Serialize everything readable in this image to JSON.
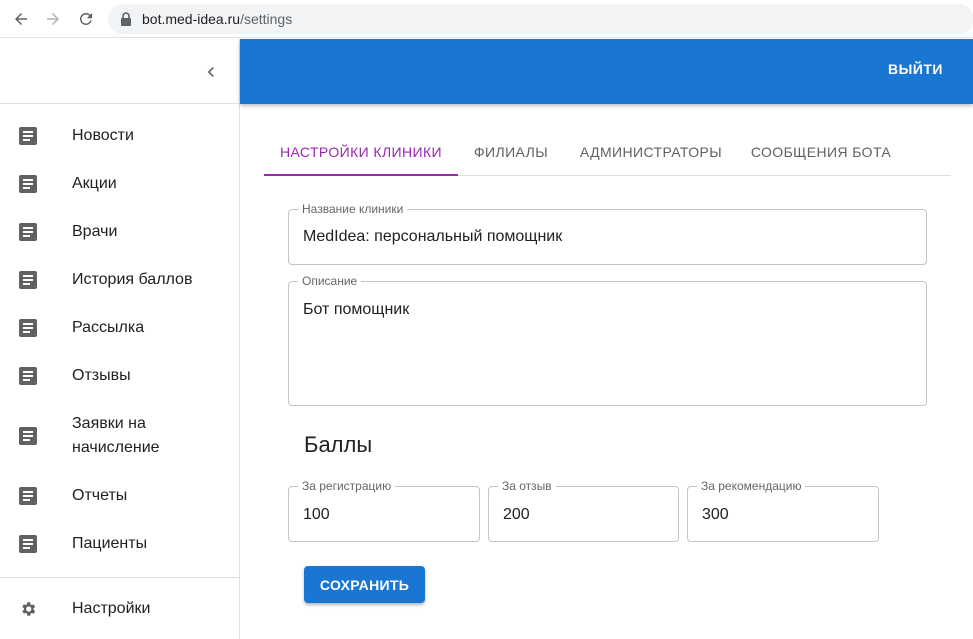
{
  "browser": {
    "url_host": "bot.med-idea.ru",
    "url_path": "/settings",
    "back_icon": "arrow-left-icon",
    "forward_icon": "arrow-right-icon",
    "reload_icon": "reload-icon"
  },
  "sidebar": {
    "collapse_icon": "chevron-left-icon",
    "items": [
      {
        "label": "Новости",
        "icon": "document-icon"
      },
      {
        "label": "Акции",
        "icon": "document-icon"
      },
      {
        "label": "Врачи",
        "icon": "document-icon"
      },
      {
        "label": "История баллов",
        "icon": "document-icon"
      },
      {
        "label": "Рассылка",
        "icon": "document-icon"
      },
      {
        "label": "Отзывы",
        "icon": "document-icon"
      },
      {
        "label": "Заявки на начисление",
        "icon": "document-icon"
      },
      {
        "label": "Отчеты",
        "icon": "document-icon"
      },
      {
        "label": "Пациенты",
        "icon": "document-icon"
      }
    ],
    "settings": {
      "label": "Настройки",
      "icon": "gear-icon"
    }
  },
  "appbar": {
    "logout_label": "ВЫЙТИ",
    "color": "#1976d2"
  },
  "tabs": [
    {
      "label": "НАСТРОЙКИ КЛИНИКИ",
      "active": true
    },
    {
      "label": "ФИЛИАЛЫ",
      "active": false
    },
    {
      "label": "АДМИНИСТРАТОРЫ",
      "active": false
    },
    {
      "label": "СООБЩЕНИЯ БОТА",
      "active": false
    }
  ],
  "form": {
    "clinic_name": {
      "label": "Название клиники",
      "value": "MedIdea: персональный помощник"
    },
    "description": {
      "label": "Описание",
      "value": "Бот помощник"
    },
    "points_title": "Баллы",
    "points": [
      {
        "label": "За регистрацию",
        "value": "100"
      },
      {
        "label": "За отзыв",
        "value": "200"
      },
      {
        "label": "За рекомендацию",
        "value": "300"
      }
    ],
    "save_label": "СОХРАНИТЬ"
  },
  "colors": {
    "primary": "#1976d2",
    "tab_active": "#9c27b0"
  }
}
